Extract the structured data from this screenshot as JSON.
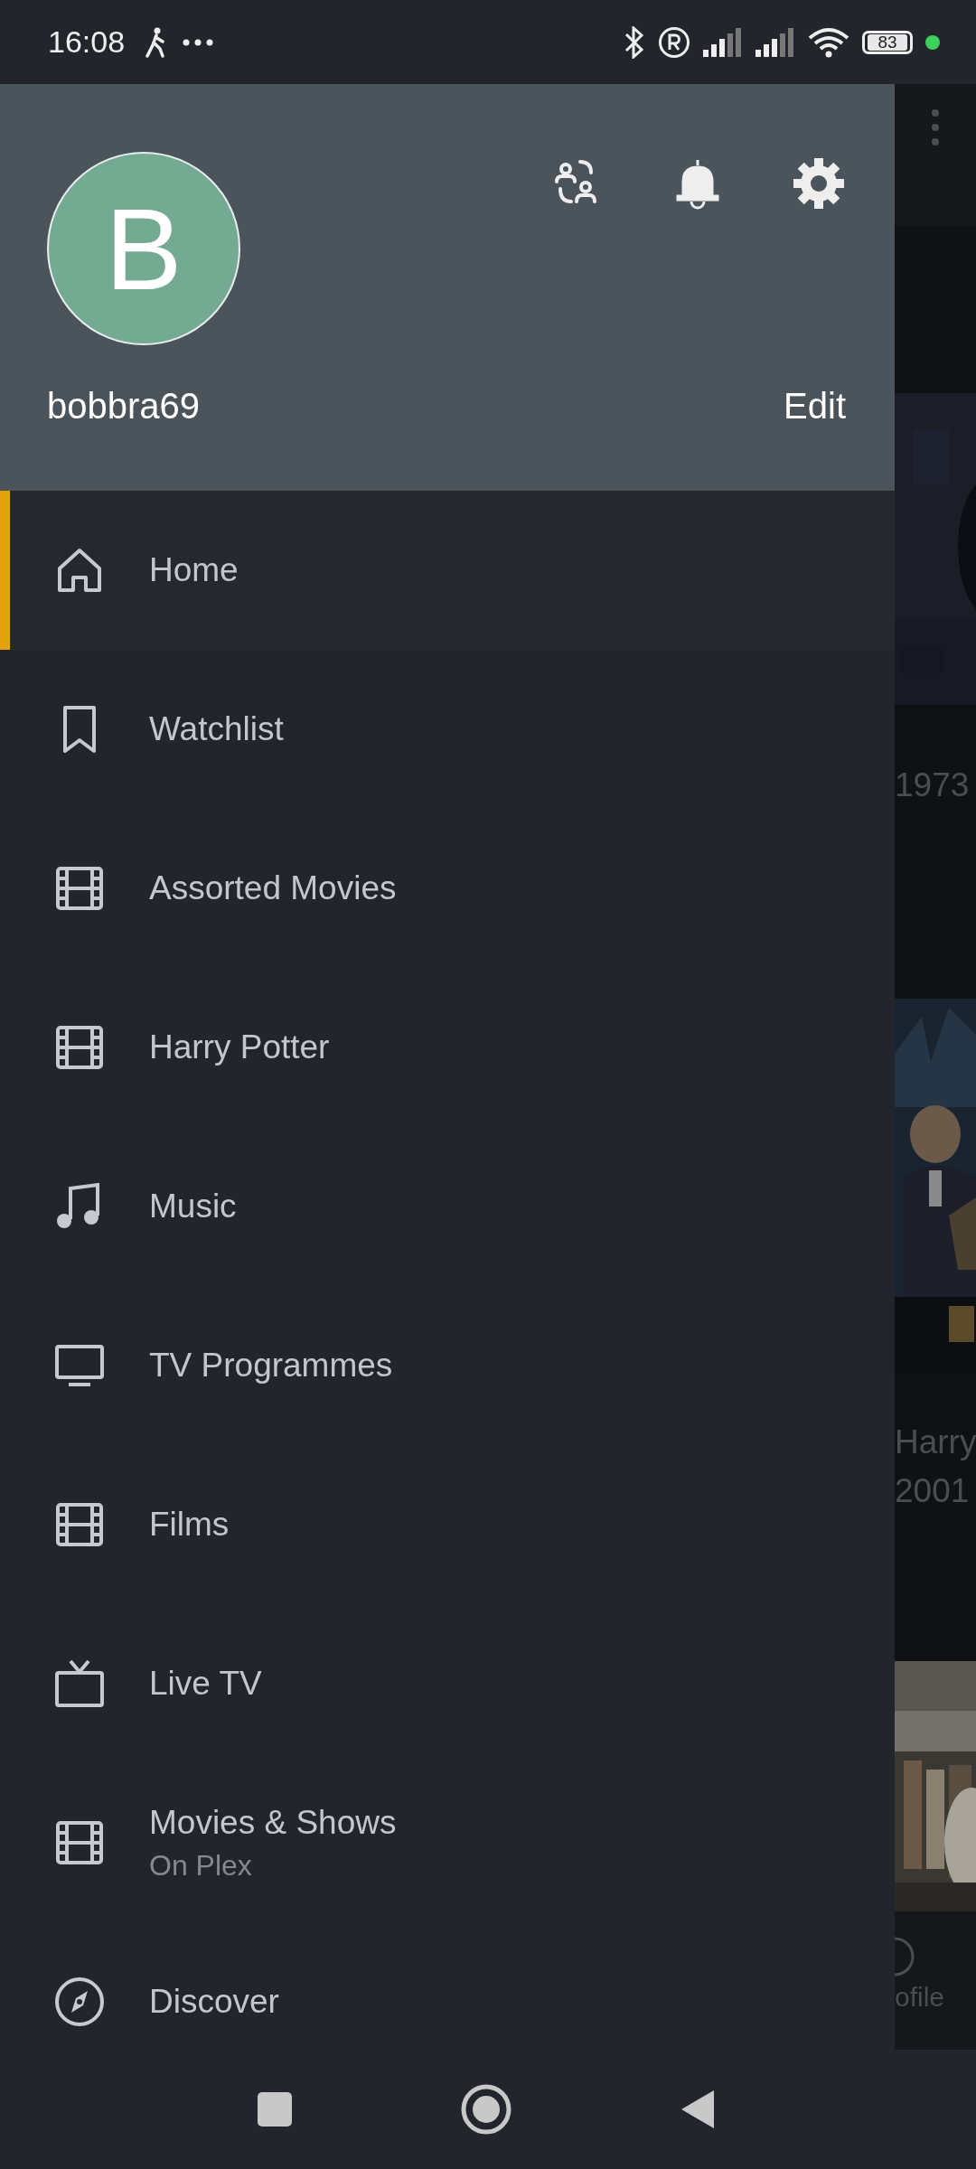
{
  "status_bar": {
    "time": "16:08",
    "battery": "83"
  },
  "header": {
    "avatar_letter": "B",
    "username": "bobbra69",
    "edit": "Edit"
  },
  "menu": [
    {
      "label": "Home",
      "kind": "home",
      "selected": true
    },
    {
      "label": "Watchlist",
      "kind": "bookmark",
      "selected": false
    },
    {
      "label": "Assorted Movies",
      "kind": "film",
      "selected": false
    },
    {
      "label": "Harry Potter",
      "kind": "film",
      "selected": false
    },
    {
      "label": "Music",
      "kind": "music",
      "selected": false
    },
    {
      "label": "TV Programmes",
      "kind": "monitor",
      "selected": false
    },
    {
      "label": "Films",
      "kind": "film",
      "selected": false
    },
    {
      "label": "Live TV",
      "kind": "tv",
      "selected": false
    },
    {
      "label": "Movies & Shows",
      "sublabel": "On Plex",
      "kind": "film",
      "selected": false
    },
    {
      "label": "Discover",
      "kind": "compass",
      "selected": false
    }
  ],
  "background": {
    "year": "1973",
    "title": "Harry",
    "year_2": "2001",
    "tab_label": "ofile"
  }
}
